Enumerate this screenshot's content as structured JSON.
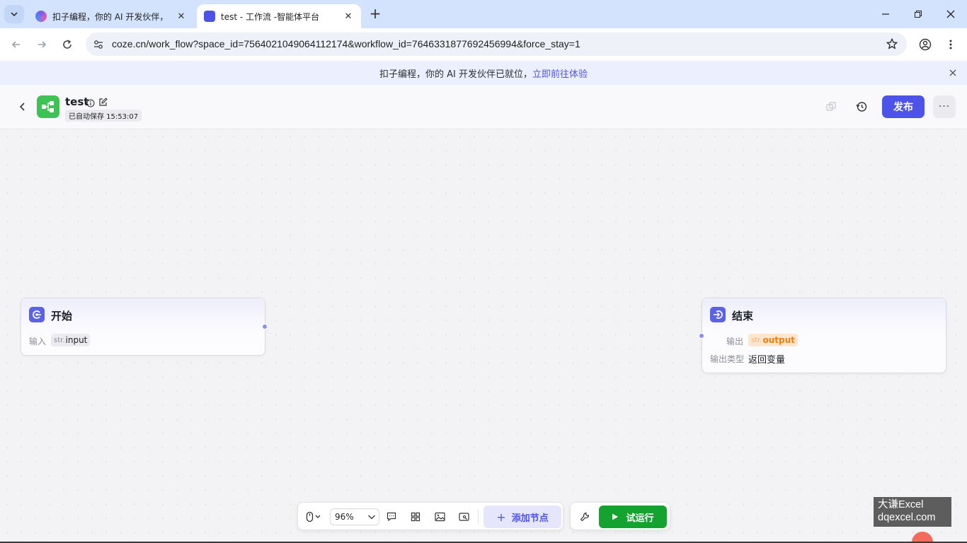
{
  "browser": {
    "tabs": [
      {
        "title": "扣子编程，你的 AI 开发伙伴，",
        "active": false
      },
      {
        "title": "test - 工作流 -智能体平台",
        "active": true
      }
    ],
    "url": "coze.cn/work_flow?space_id=7564021049064112174&workflow_id=7646331877692456994&force_stay=1"
  },
  "banner": {
    "text": "扣子编程，你的 AI 开发伙伴已就位，",
    "link": "立即前往体验"
  },
  "header": {
    "workflow_name": "test",
    "autosave": "已自动保存 15:53:07",
    "publish_label": "发布",
    "more_label": "···"
  },
  "nodes": {
    "start": {
      "title": "开始",
      "input_label": "输入",
      "input_type": "str.",
      "input_name": "input"
    },
    "end": {
      "title": "结束",
      "output_label": "输出",
      "output_type": "str.",
      "output_name": "output",
      "output_kind_label": "输出类型",
      "output_kind_value": "返回变量"
    }
  },
  "bottom_toolbar": {
    "zoom": "96%",
    "add_node_label": "添加节点",
    "test_run_label": "试运行"
  },
  "watermark": {
    "line1": "大谦Excel",
    "line2": "dqexcel.com"
  },
  "colors": {
    "accent": "#4d53e8",
    "run_green": "#14a32e",
    "logo_green": "#3ec254",
    "output_orange": "#f07e0a"
  }
}
